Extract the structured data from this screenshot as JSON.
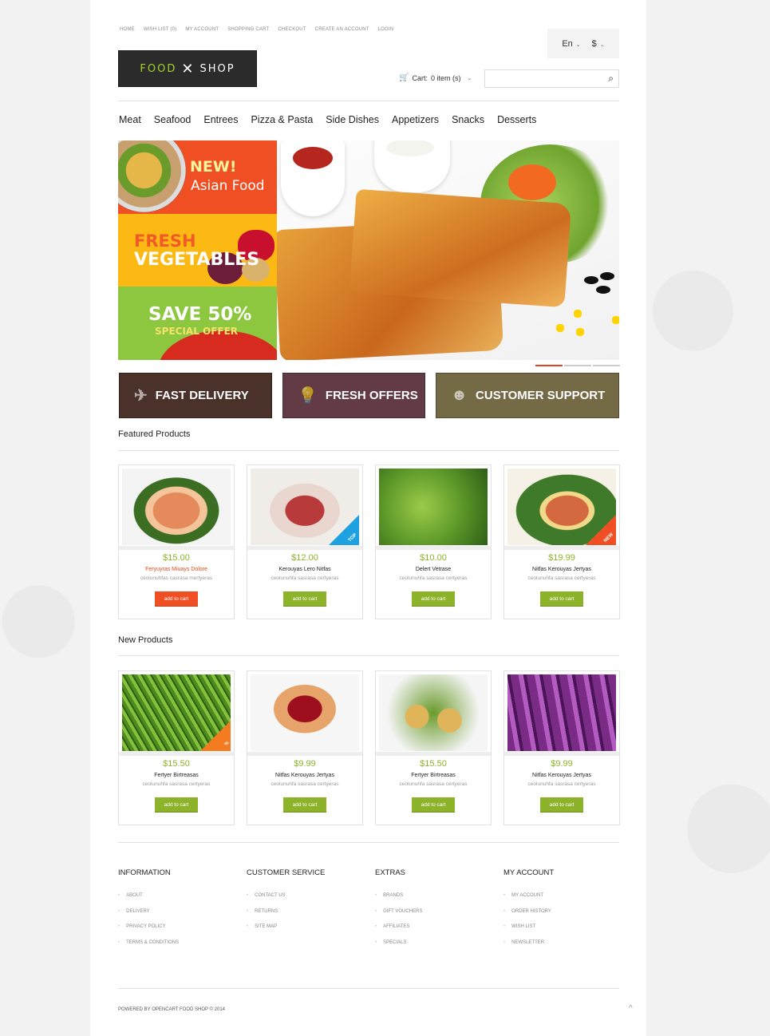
{
  "top_links": [
    "HOME",
    "WISH LIST (0)",
    "MY ACCOUNT",
    "SHOPPING CART",
    "CHECKOUT",
    "CREATE AN ACCOUNT",
    "LOGIN"
  ],
  "logo": {
    "word1": "FOOD",
    "word2": "SHOP",
    "icon": "fork-spoon-icon",
    "accent": "#a7d129"
  },
  "language": {
    "selected": "En"
  },
  "currency": {
    "selected": "$"
  },
  "cart": {
    "label": "Cart:",
    "summary": "0 item (s)",
    "icon": "cart-icon"
  },
  "search": {
    "placeholder": "",
    "value": "",
    "icon": "search-icon"
  },
  "nav": [
    "Meat",
    "Seafood",
    "Entrees",
    "Pizza & Pasta",
    "Side Dishes",
    "Appetizers",
    "Snacks",
    "Desserts"
  ],
  "promos": [
    {
      "line1": "NEW!",
      "line2": "Asian Food",
      "color": "#f04e23"
    },
    {
      "line1": "FRESH",
      "line2": "VEGETABLES",
      "color": "#fdb913"
    },
    {
      "line1": "SAVE 50%",
      "line2": "SPECIAL OFFER",
      "color": "#8dc63f"
    }
  ],
  "slider": {
    "active_index": 0,
    "count": 3,
    "accent": "#e04224"
  },
  "features": [
    {
      "label": "FAST DELIVERY",
      "icon": "paper-plane-icon",
      "color": "#4a3129"
    },
    {
      "label": "FRESH OFFERS",
      "icon": "light-bulb-icon",
      "color": "#633b47"
    },
    {
      "label": "CUSTOMER SUPPORT",
      "icon": "support-face-icon",
      "color": "#746a46"
    }
  ],
  "featured": {
    "title": "Featured Products",
    "items": [
      {
        "price": "$15.00",
        "name": "Feryuyras Miuays Dolore",
        "desc": "ceolunuhfas casrasa mertyeras",
        "button": "add to cart",
        "badge": ""
      },
      {
        "price": "$12.00",
        "name": "Kerouyas Lero Nitfas",
        "desc": "ceolunuhfa sasrasa certyeras",
        "button": "add to cart",
        "badge": "TOP"
      },
      {
        "price": "$10.00",
        "name": "Delert Vetrase",
        "desc": "ceolunuhfa sasrasa certyeras",
        "button": "add to cart",
        "badge": ""
      },
      {
        "price": "$19.99",
        "name": "Nitfas Kerouyas Jertyas",
        "desc": "ceolunuhfa sasrasa certyeras",
        "button": "add to cart",
        "badge": "NEW"
      }
    ]
  },
  "new_products": {
    "title": "New Products",
    "items": [
      {
        "price": "$15.50",
        "name": "Fertyer Birtreasas",
        "desc": "ceolunuhfa sasrasa certyeras",
        "button": "add to cart",
        "badge": "%"
      },
      {
        "price": "$9.99",
        "name": "Nitfas Kerouyas Jertyas",
        "desc": "ceolunuhfa sasrasa certyeras",
        "button": "add to cart",
        "badge": ""
      },
      {
        "price": "$15.50",
        "name": "Fertyer Birtreasas",
        "desc": "ceolunuhfa sasrasa certyeras",
        "button": "add to cart",
        "badge": ""
      },
      {
        "price": "$9.99",
        "name": "Nitfas Kerouyas Jertyas",
        "desc": "ceolunuhfa sasrasa certyeras",
        "button": "add to cart",
        "badge": ""
      }
    ]
  },
  "footer": {
    "columns": [
      {
        "title": "INFORMATION",
        "links": [
          "ABOUT",
          "DELIVERY",
          "PRIVACY POLICY",
          "TERMS & CONDITIONS"
        ]
      },
      {
        "title": "CUSTOMER SERVICE",
        "links": [
          "CONTACT US",
          "RETURNS",
          "SITE MAP"
        ]
      },
      {
        "title": "EXTRAS",
        "links": [
          "BRANDS",
          "GIFT VOUCHERS",
          "AFFILIATES",
          "SPECIALS"
        ]
      },
      {
        "title": "MY ACCOUNT",
        "links": [
          "MY ACCOUNT",
          "ORDER HISTORY",
          "WISH LIST",
          "NEWSLETTER"
        ]
      }
    ],
    "copyright": "POWERED BY OPENCART FOOD SHOP © 2014",
    "to_top_icon": "chevron-up-icon"
  }
}
